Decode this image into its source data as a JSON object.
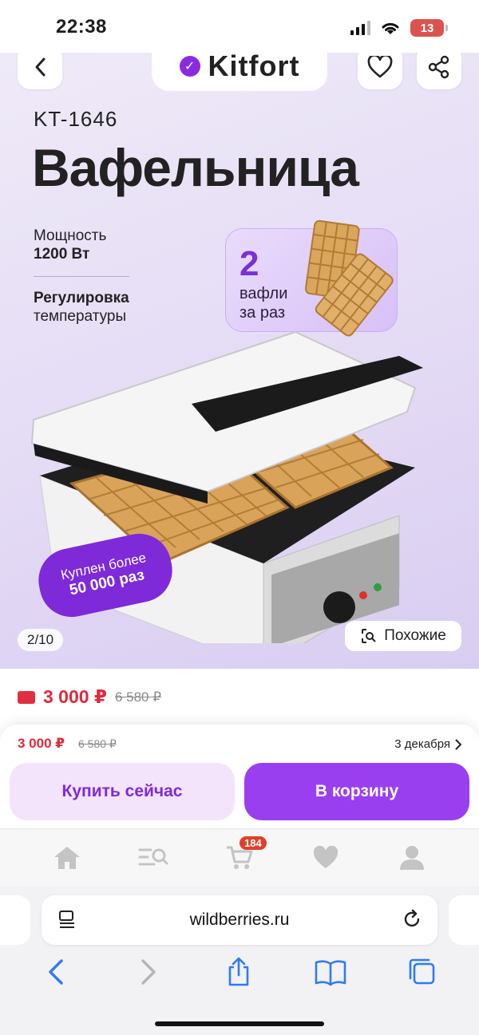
{
  "status_bar": {
    "time": "22:38",
    "battery": "13"
  },
  "product": {
    "brand": "Kitfort",
    "model": "KT-1646",
    "title": "Вафельница",
    "feature1_line1": "Мощность",
    "feature1_line2": "1200 Вт",
    "feature2_line1": "Регулировка",
    "feature2_line2": "температуры",
    "waffle_count": "2",
    "waffle_line1": "вафли",
    "waffle_line2": "за раз",
    "promo_line1": "Куплен более",
    "promo_line2": "50 000 раз",
    "image_counter": "2/10",
    "similar_label": "Похожие"
  },
  "price": {
    "current": "3 000 ₽",
    "old": "6 580 ₽"
  },
  "purchase": {
    "price": "3 000 ₽",
    "old": "6 580 ₽",
    "delivery": "3 декабря",
    "buy_now": "Купить сейчас",
    "add_to_cart": "В корзину"
  },
  "bottom_nav": {
    "items": [
      "home",
      "catalog",
      "cart",
      "favorites",
      "profile"
    ],
    "cart_badge": "184"
  },
  "browser": {
    "url": "wildberries.ru"
  },
  "colors": {
    "accent": "#9a3ff0",
    "price": "#e02a3b",
    "brand_purple": "#7e2ad8"
  }
}
